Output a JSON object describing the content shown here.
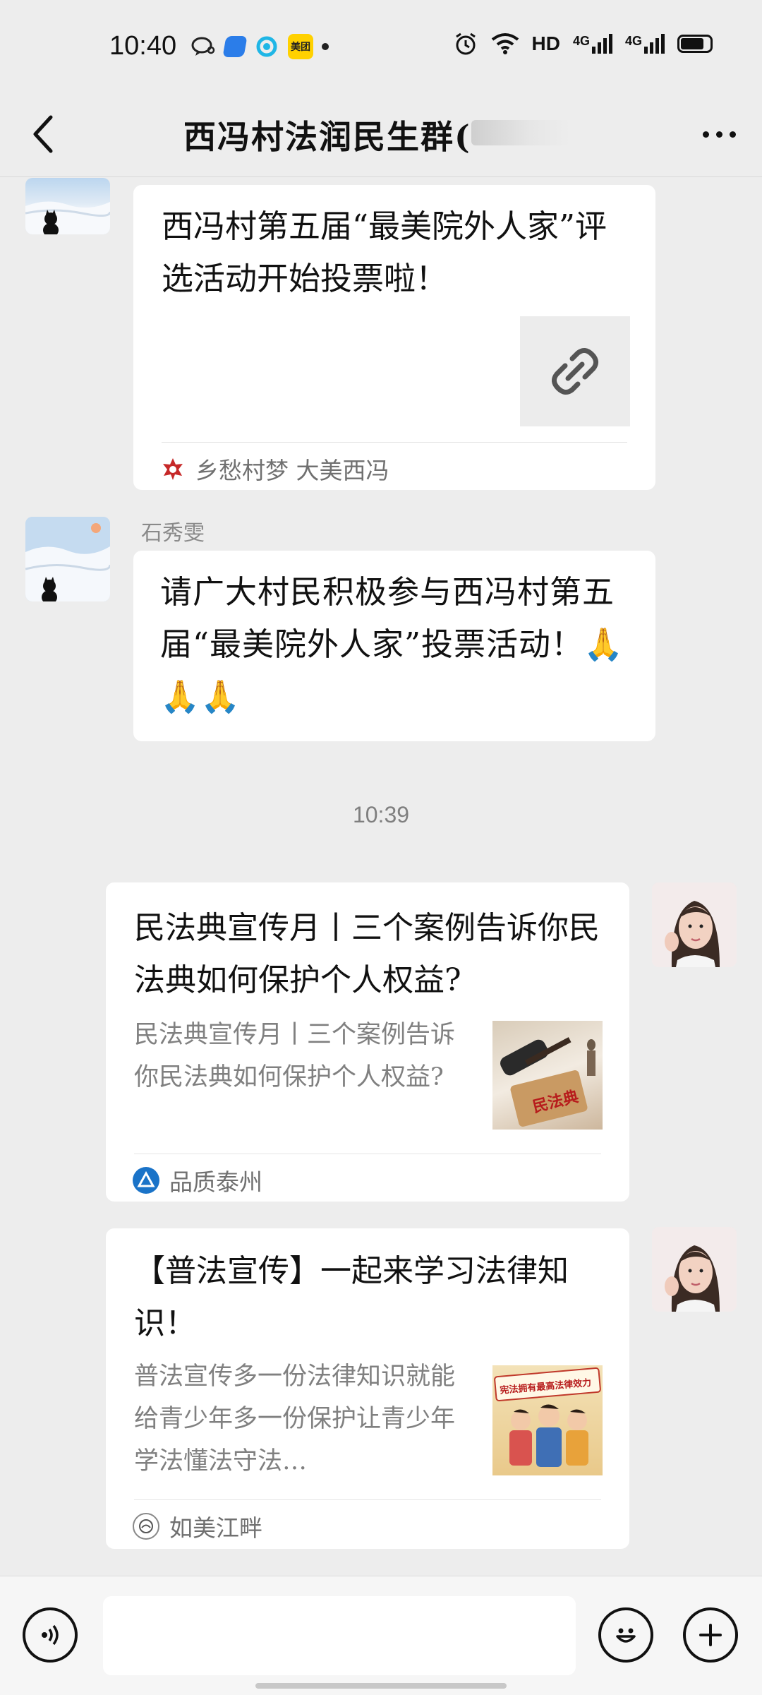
{
  "status_bar": {
    "time": "10:40",
    "network_labels": [
      "HD",
      "4G",
      "4G"
    ],
    "meituan_label": "美团"
  },
  "header": {
    "title": "西冯村法润民生群("
  },
  "messages": [
    {
      "type": "link_card",
      "title": "西冯村第五届“最美院外人家”评选活动开始投票啦！",
      "source": "乡愁村梦 大美西冯"
    },
    {
      "type": "text",
      "sender": "石秀雯",
      "text": "请广大村民积极参与西冯村第五届“最美院外人家”投票活动！🙏🙏🙏"
    },
    {
      "type": "timestamp",
      "text": "10:39"
    },
    {
      "type": "article_card",
      "title": "民法典宣传月丨三个案例告诉你民法典如何保护个人权益?",
      "description": "民法典宣传月丨三个案例告诉你民法典如何保护个人权益?",
      "thumb_text": "民法典",
      "source": "品质泰州"
    },
    {
      "type": "article_card",
      "title": "【普法宣传】一起来学习法律知识！",
      "description": "普法宣传多一份法律知识就能给青少年多一份保护让青少年学法懂法守法…",
      "thumb_text": "宪法拥有最高法律效力",
      "source": "如美江畔"
    }
  ],
  "input": {
    "placeholder": ""
  },
  "colors": {
    "background": "#ededed",
    "bubble": "#ffffff",
    "muted_text": "#808080"
  }
}
